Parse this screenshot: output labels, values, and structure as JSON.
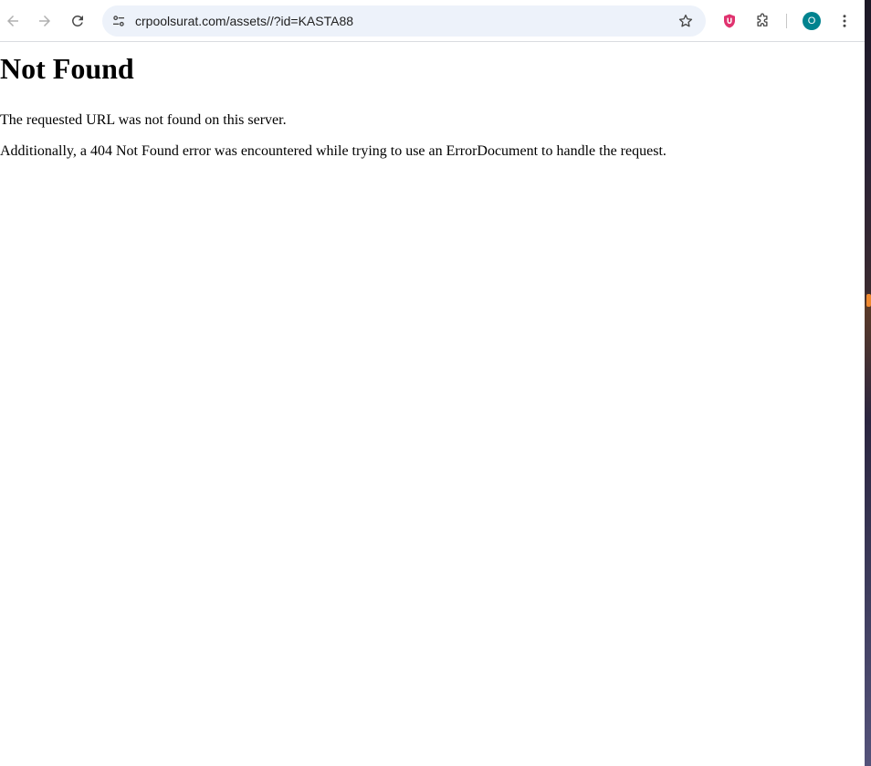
{
  "browser": {
    "url": "crpoolsurat.com/assets//?id=KASTA88",
    "profile_initial": "O",
    "colors": {
      "omnibox_bg": "#edf2fa",
      "avatar_bg": "#00838f",
      "extension_shield": "#e0336f"
    },
    "icons": {
      "back": "arrow-left-icon",
      "forward": "arrow-right-icon",
      "reload": "reload-icon",
      "site_info": "tune-icon",
      "bookmark": "star-outline-icon",
      "extension": "shield-u-icon",
      "extensions_menu": "puzzle-icon",
      "menu": "kebab-icon"
    }
  },
  "page": {
    "heading": "Not Found",
    "message": "The requested URL was not found on this server.",
    "detail": "Additionally, a 404 Not Found error was encountered while trying to use an ErrorDocument to handle the request."
  }
}
